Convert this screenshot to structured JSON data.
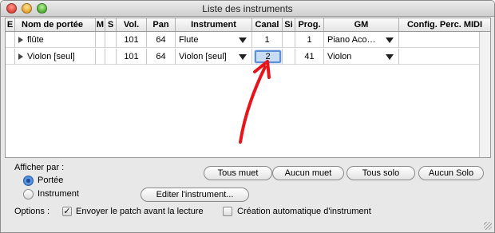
{
  "window": {
    "title": "Liste des instruments"
  },
  "table": {
    "columns": [
      "E",
      "Nom de portée",
      "M",
      "S",
      "Vol.",
      "Pan",
      "Instrument",
      "Canal",
      "Si",
      "Prog.",
      "GM",
      "Config. Perc. MIDI"
    ],
    "rows": [
      {
        "name": "flûte",
        "vol": "101",
        "pan": "64",
        "instrument": "Flute",
        "canal": "1",
        "prog": "1",
        "gm": "Piano Aco…"
      },
      {
        "name": "Violon [seul]",
        "vol": "101",
        "pan": "64",
        "instrument": "Violon [seul]",
        "canal": "2",
        "prog": "41",
        "gm": "Violon"
      }
    ]
  },
  "annotation": {
    "arrow_color": "#e8141b"
  },
  "display_by": {
    "label": "Afficher par :",
    "options": [
      {
        "label": "Portée",
        "selected": true
      },
      {
        "label": "Instrument",
        "selected": false
      }
    ]
  },
  "buttons": {
    "mute_all": "Tous muet",
    "no_mute": "Aucun muet",
    "solo_all": "Tous solo",
    "no_solo": "Aucun Solo",
    "edit_instrument": "Editer l'instrument..."
  },
  "options": {
    "label": "Options :",
    "send_patch": {
      "label": "Envoyer le patch avant la lecture",
      "checked": true
    },
    "auto_create": {
      "label": "Création automatique d'instrument",
      "checked": false
    }
  }
}
